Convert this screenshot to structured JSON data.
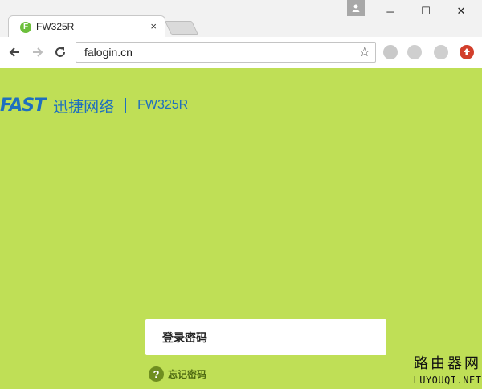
{
  "browser": {
    "tab": {
      "title": "FW325R",
      "favicon_letter": "F",
      "close_glyph": "×"
    },
    "window": {
      "minimize": "─",
      "maximize": "☐",
      "close": "✕"
    },
    "address": {
      "url": "falogin.cn"
    },
    "icons": [
      "back-icon",
      "forward-icon",
      "reload-icon",
      "star-icon",
      "extension-icon",
      "profile-icon"
    ]
  },
  "page": {
    "brand": {
      "logo": "FAST",
      "name": "迅捷网络",
      "model": "FW325R"
    },
    "login": {
      "password_placeholder": "登录密码",
      "forgot_icon": "?",
      "forgot_label": "忘记密码"
    },
    "watermark": {
      "line1": "路由器网",
      "line2": "LUYOUQI.NET"
    },
    "colors": {
      "background": "#bfdf56",
      "brand": "#1e6fbf",
      "forgot": "#6f8e1f"
    }
  }
}
